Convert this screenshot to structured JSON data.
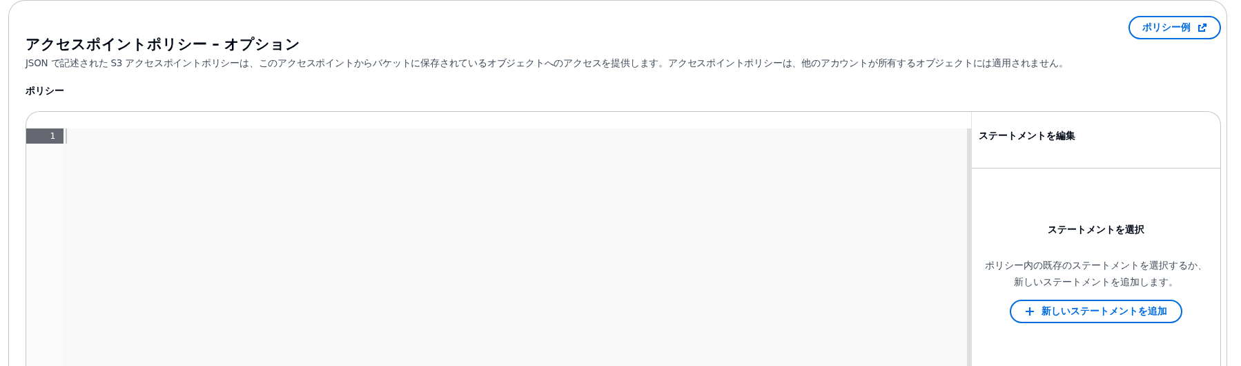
{
  "header": {
    "title": "アクセスポイントポリシー – オプション",
    "description": "JSON で記述された S3 アクセスポイントポリシーは、このアクセスポイントからバケットに保存されているオブジェクトへのアクセスを提供します。アクセスポイントポリシーは、他のアカウントが所有するオブジェクトには適用されません。",
    "example_button": "ポリシー例"
  },
  "policy_label": "ポリシー",
  "editor": {
    "line_numbers": [
      "1"
    ]
  },
  "statement_panel": {
    "title": "ステートメントを編集",
    "empty_title": "ステートメントを選択",
    "empty_description": "ポリシー内の既存のステートメントを選択するか、新しいステートメントを追加します。",
    "add_button": "新しいステートメントを追加"
  }
}
